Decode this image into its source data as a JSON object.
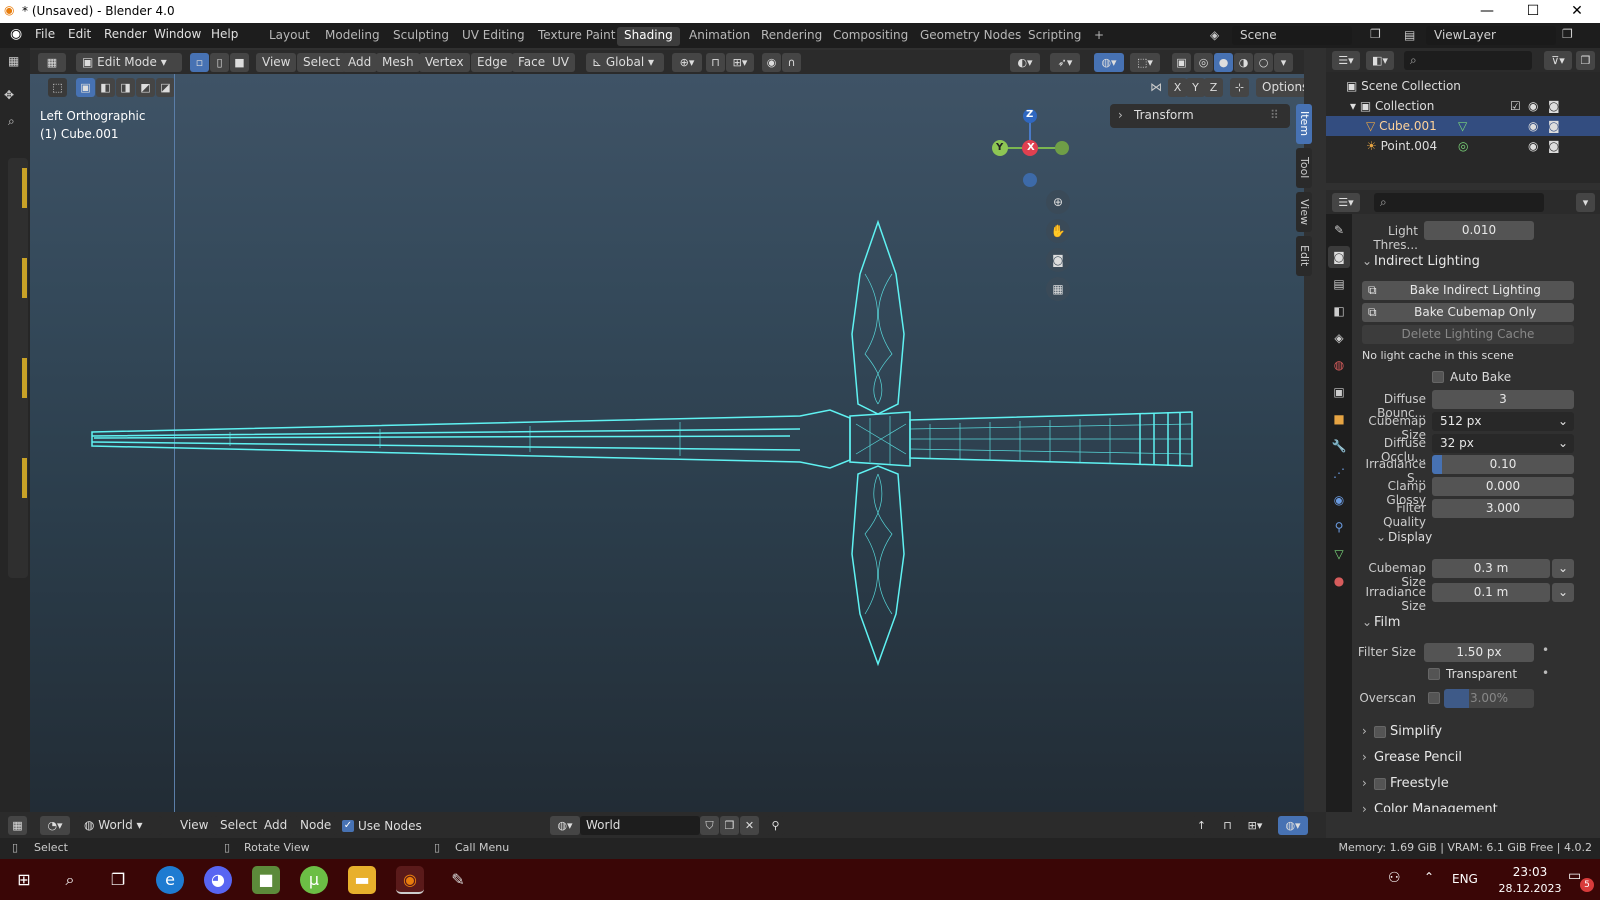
{
  "window": {
    "title": "* (Unsaved) - Blender 4.0",
    "minimize": "—",
    "maximize": "☐",
    "close": "✕"
  },
  "menu": [
    "File",
    "Edit",
    "Render",
    "Window",
    "Help"
  ],
  "workspaces": [
    "Layout",
    "Modeling",
    "Sculpting",
    "UV Editing",
    "Texture Paint",
    "Shading",
    "Animation",
    "Rendering",
    "Compositing",
    "Geometry Nodes",
    "Scripting"
  ],
  "active_workspace": "Shading",
  "scene": {
    "label": "Scene",
    "viewlayer": "ViewLayer"
  },
  "viewport_header": {
    "mode": "Edit Mode",
    "menus": [
      "View",
      "Select",
      "Add",
      "Mesh",
      "Vertex",
      "Edge",
      "Face",
      "UV"
    ],
    "orientation": "Global",
    "axes": [
      "X",
      "Y",
      "Z"
    ],
    "options": "Options"
  },
  "viewport": {
    "view_name": "Left Orthographic",
    "object": "(1) Cube.001",
    "transform_panel": "Transform",
    "side_tabs": [
      "Item",
      "Tool",
      "View",
      "Edit"
    ],
    "gizmo": {
      "z": "Z",
      "y": "Y",
      "x": "X"
    },
    "wire_color": "#5ff2f2"
  },
  "outliner": {
    "root": "Scene Collection",
    "collection": "Collection",
    "items": [
      {
        "name": "Cube.001",
        "selected": true
      },
      {
        "name": "Point.004",
        "selected": false
      }
    ]
  },
  "properties": {
    "light_threshold": {
      "label": "Light Thres...",
      "value": "0.010"
    },
    "indirect_lighting": {
      "title": "Indirect Lighting",
      "bake_indirect": "Bake Indirect Lighting",
      "bake_cubemap": "Bake Cubemap Only",
      "delete_cache": "Delete Lighting Cache",
      "no_cache": "No light cache in this scene",
      "auto_bake": "Auto Bake",
      "fields": [
        {
          "label": "Diffuse Bounc...",
          "value": "3"
        },
        {
          "label": "Cubemap Size",
          "value": "512 px"
        },
        {
          "label": "Diffuse Occlu...",
          "value": "32 px"
        },
        {
          "label": "Irradiance S...",
          "value": "0.10"
        },
        {
          "label": "Clamp Glossy",
          "value": "0.000"
        },
        {
          "label": "Filter Quality",
          "value": "3.000"
        }
      ],
      "display": {
        "title": "Display",
        "cubemap_size": {
          "label": "Cubemap Size",
          "value": "0.3 m"
        },
        "irradiance_size": {
          "label": "Irradiance Size",
          "value": "0.1 m"
        }
      }
    },
    "film": {
      "title": "Film",
      "filter_size": {
        "label": "Filter Size",
        "value": "1.50 px"
      },
      "transparent": "Transparent",
      "overscan": {
        "label": "Overscan",
        "value": "3.00%"
      }
    },
    "collapsed": [
      "Simplify",
      "Grease Pencil",
      "Freestyle",
      "Color Management"
    ]
  },
  "node_header": {
    "world_type": "World",
    "menus": [
      "View",
      "Select",
      "Add",
      "Node"
    ],
    "use_nodes": "Use Nodes",
    "world_name": "World"
  },
  "statusbar": {
    "select": "Select",
    "rotate": "Rotate View",
    "call_menu": "Call Menu",
    "memory": "Memory: 1.69 GiB | VRAM: 6.1 GiB Free | 4.0.2"
  },
  "taskbar": {
    "lang": "ENG",
    "time": "23:03",
    "date": "28.12.2023",
    "notifications": "5"
  }
}
